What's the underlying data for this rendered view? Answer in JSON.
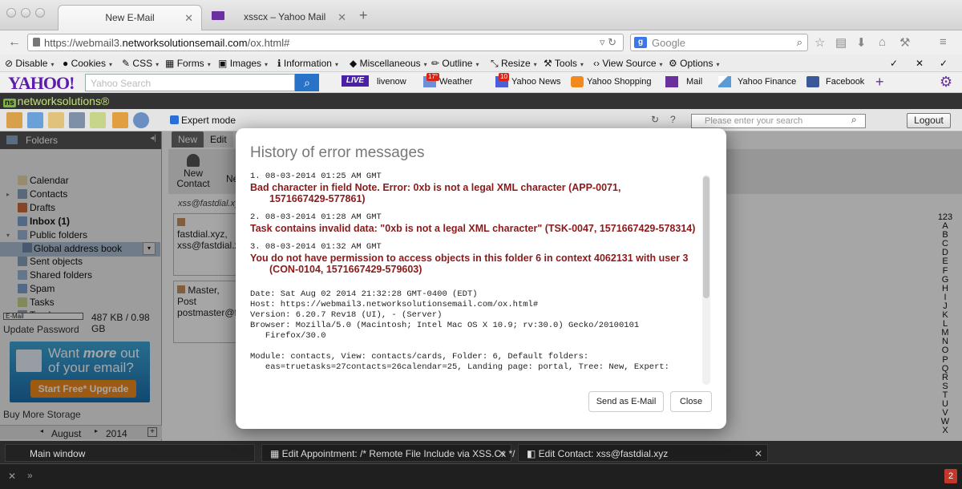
{
  "browser": {
    "tabs": [
      {
        "label": "New E-Mail"
      },
      {
        "label": "xsscx – Yahoo Mail"
      }
    ],
    "url_prefix": "https://webmail3.",
    "url_domain": "networksolutionsemail.com",
    "url_suffix": "/ox.html#",
    "search_engine": "Google",
    "search_placeholder": "Google"
  },
  "devbar": {
    "items": [
      "Disable",
      "Cookies",
      "CSS",
      "Forms",
      "Images",
      "Information",
      "Miscellaneous",
      "Outline",
      "Resize",
      "Tools",
      "View Source",
      "Options"
    ]
  },
  "yahoo": {
    "logo": "YAHOO!",
    "search_placeholder": "Yahoo Search",
    "live": "LIVE",
    "links": [
      "livenow",
      "Weather",
      "Yahoo News",
      "Yahoo Shopping",
      "Mail",
      "Yahoo Finance",
      "Facebook"
    ],
    "weather_badge": "17°",
    "news_badge": "10"
  },
  "ns": {
    "brand": "networksolutions",
    "brand_suffix": "®"
  },
  "app": {
    "expert_mode": "Expert mode",
    "global_search_placeholder": "Please enter your search",
    "logout": "Logout"
  },
  "sidebar": {
    "title": "Folders",
    "items": [
      "Calendar",
      "Contacts",
      "Drafts",
      "Inbox (1)",
      "Public folders",
      "Global address book",
      "Sent objects",
      "Shared folders",
      "Spam",
      "Tasks",
      "Trash"
    ],
    "storage_label": "E-Mail",
    "quota": "487 KB / 0.98 GB",
    "update_password": "Update Password",
    "promo_line1": "Want ",
    "promo_more": "more",
    "promo_line1b": " out",
    "promo_line2": "of your email?",
    "promo_button": "Start Free* Upgrade",
    "buy_more": "Buy More Storage",
    "month": "August",
    "year": "2014"
  },
  "content": {
    "tabs": [
      "New",
      "Edit"
    ],
    "new_contact": "New Contact",
    "new_contact_line1": "New",
    "new_contact_line2": "Contact",
    "ne_partial": "Ne",
    "header_partial": "xss@fastdial.xyz",
    "card1_name": "fastdial.xyz,",
    "card1_email": "xss@fastdial.xyz",
    "card2_name": "Master, Post",
    "card2_email": "postmaster@fa",
    "alphabet": [
      "123",
      "A",
      "B",
      "C",
      "D",
      "E",
      "F",
      "G",
      "H",
      "I",
      "J",
      "K",
      "L",
      "M",
      "N",
      "O",
      "P",
      "Q",
      "R",
      "S",
      "T",
      "U",
      "V",
      "W",
      "X"
    ]
  },
  "modal": {
    "title": "History of error messages",
    "errors": [
      {
        "meta": "1. 08-03-2014 01:25 AM GMT",
        "line1": "Bad character in field Note. Error: 0xb is not a legal XML character (APP-0071,",
        "line2": "1571667429-577861)"
      },
      {
        "meta": "2. 08-03-2014 01:28 AM GMT",
        "line1": "Task contains invalid data: \"0xb is not a legal XML character\" (TSK-0047, 1571667429-578314)",
        "line2": ""
      },
      {
        "meta": "3. 08-03-2014 01:32 AM GMT",
        "line1": "You do not have permission to access objects in this folder 6 in context 4062131 with user 3",
        "line2": "(CON-0104, 1571667429-579603)"
      }
    ],
    "details": "Date: Sat Aug 02 2014 21:32:28 GMT-0400 (EDT)\nHost: https://webmail3.networksolutionsemail.com/ox.html#\nVersion: 6.20.7 Rev18 (UI), - (Server)\nBrowser: Mozilla/5.0 (Macintosh; Intel Mac OS X 10.9; rv:30.0) Gecko/20100101\n   Firefox/30.0\n\nModule: contacts, View: contacts/cards, Folder: 6, Default folders:\n   eas=truetasks=27contacts=26calendar=25, Landing page: portal, Tree: New, Expert:",
    "send_button": "Send as E-Mail",
    "close_button": "Close"
  },
  "taskbar": {
    "items": [
      "Main window",
      "Edit Appointment: /* Remote File Include via XSS.Cx */ /*",
      "Edit Contact: xss@fastdial.xyz"
    ],
    "counter": "2"
  }
}
